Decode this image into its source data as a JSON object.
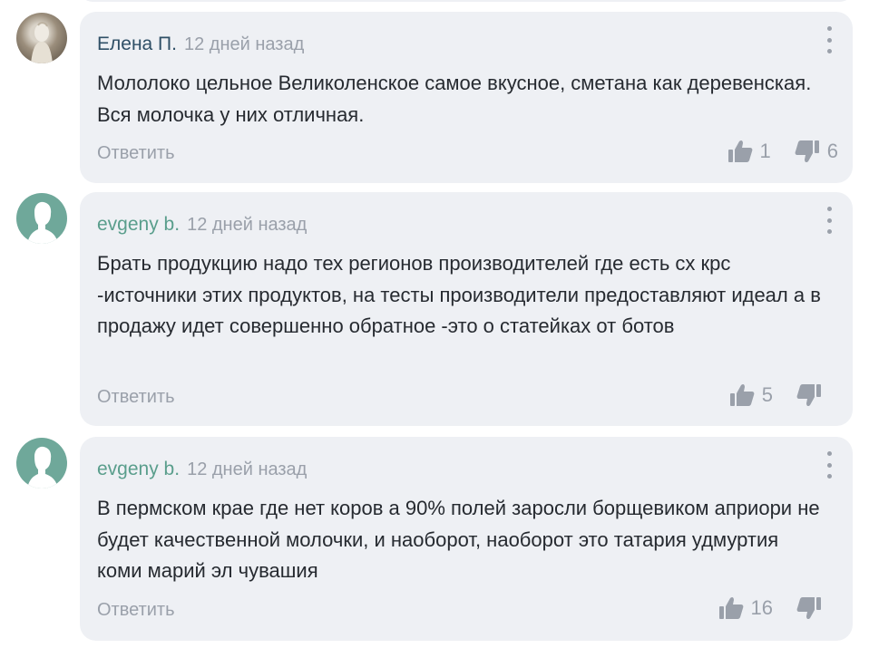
{
  "comments": [
    {
      "author": "Елена П.",
      "time": "12 дней назад",
      "text": "Мололоко цельное Великоленское самое вкусное, сметана как деревенская. Вся молочка у них отличная.",
      "reply_label": "Ответить",
      "likes": "1",
      "dislikes": "6",
      "avatar": "photo"
    },
    {
      "author": "evgeny b.",
      "time": "12 дней назад",
      "text": "Брать продукцию надо тех регионов производителей где есть сх крс -источники этих продуктов, на тесты производители предоставляют идеал а в продажу идет совершенно обратное -это о статейках от ботов",
      "reply_label": "Ответить",
      "likes": "5",
      "dislikes": "",
      "avatar": "default-user-icon"
    },
    {
      "author": "evgeny b.",
      "time": "12 дней назад",
      "text": "В пермском крае где нет коров а 90% полей заросли борщевиком априори не будет качественной молочки, и наоборот, наоборот это татария удмуртия коми марий эл чувашия",
      "reply_label": "Ответить",
      "likes": "16",
      "dislikes": "",
      "avatar": "default-user-icon"
    }
  ],
  "icons": {
    "like": "thumbs-up-icon",
    "dislike": "thumbs-down-icon",
    "menu": "more-vertical-icon"
  },
  "colors": {
    "card_bg": "#eef0f4",
    "author_name": "#2f4f66",
    "author_name_alt": "#5a9e8c",
    "muted": "#9aa0aa",
    "avatar_default": "#6fa89a"
  }
}
